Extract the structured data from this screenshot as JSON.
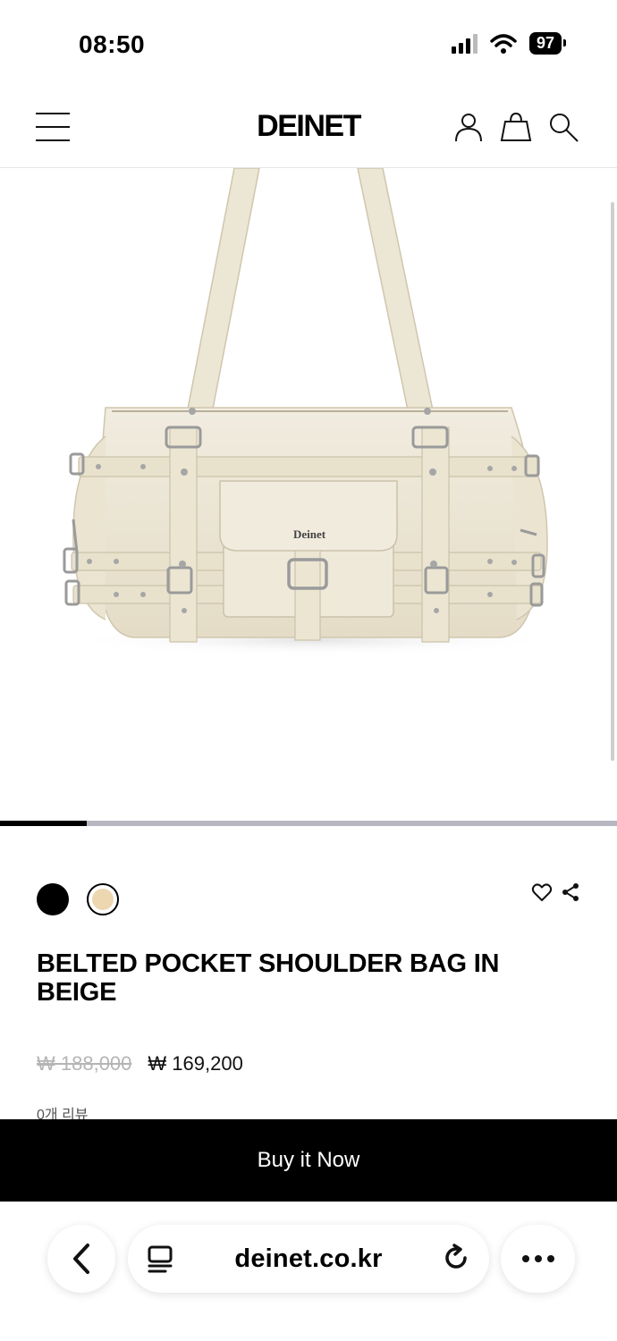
{
  "status_bar": {
    "time": "08:50",
    "battery": "97"
  },
  "header": {
    "logo": "DEINET",
    "icons": [
      "menu-icon",
      "user-icon",
      "shopping-bag-icon",
      "search-icon"
    ]
  },
  "product": {
    "image_logo": "Deinet",
    "gallery_progress": 0.14,
    "swatches": [
      {
        "name": "black",
        "color": "#000000",
        "selected": false
      },
      {
        "name": "beige",
        "color": "#ecd7b0",
        "selected": true
      }
    ],
    "title": "BELTED POCKET SHOULDER BAG IN BEIGE",
    "price_original": "₩ 188,000",
    "price_sale": "₩ 169,200",
    "reviews": "0개 리뷰"
  },
  "buy_button": {
    "label": "Buy it Now"
  },
  "browser": {
    "url": "deinet.co.kr",
    "icons": [
      "back-icon",
      "reader-icon",
      "reload-icon",
      "more-icon"
    ]
  },
  "colors": {
    "accent": "#000000",
    "progress_track": "#b7b7c2",
    "price_struck": "#b5b5b5",
    "bag_beige": "#ece6d4"
  }
}
